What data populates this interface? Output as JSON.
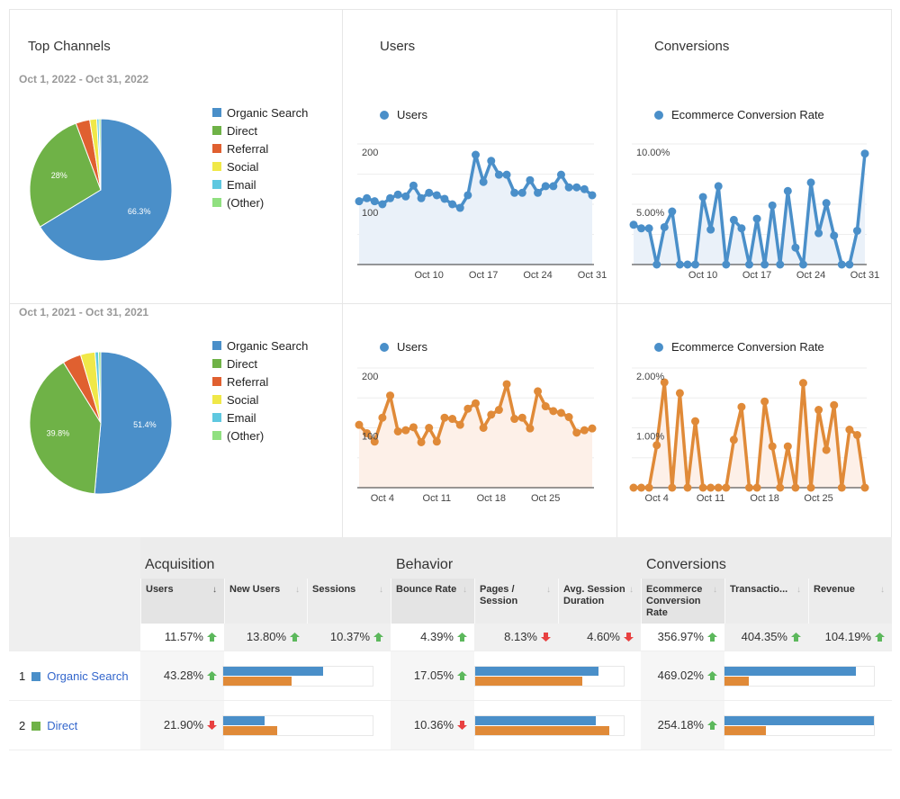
{
  "panels": {
    "top_channels_title": "Top Channels",
    "users_title": "Users",
    "conversions_title": "Conversions",
    "period_current": "Oct 1, 2022 - Oct 31, 2022",
    "period_previous": "Oct 1, 2021 - Oct 31, 2021"
  },
  "legend": [
    "Organic Search",
    "Direct",
    "Referral",
    "Social",
    "Email",
    "(Other)"
  ],
  "colors": {
    "organic": "#4a8fc9",
    "direct": "#6fb247",
    "referral": "#e06030",
    "social": "#f0e848",
    "email": "#5fc8e0",
    "other": "#90e080",
    "current_series": "#4a8fc9",
    "previous_series": "#e08a38",
    "up": "#5cb85c",
    "down": "#e84040"
  },
  "chart_data": [
    {
      "type": "pie",
      "name": "Top Channels 2022",
      "period": "Oct 1, 2022 - Oct 31, 2022",
      "labels": [
        "Organic Search",
        "Direct",
        "Referral",
        "Social",
        "Email",
        "(Other)"
      ],
      "values": [
        66.3,
        28.0,
        3.2,
        1.6,
        0.5,
        0.4
      ],
      "data_labels": [
        "66.3%",
        "28%",
        "",
        "",
        "",
        ""
      ]
    },
    {
      "type": "pie",
      "name": "Top Channels 2021",
      "period": "Oct 1, 2021 - Oct 31, 2021",
      "labels": [
        "Organic Search",
        "Direct",
        "Referral",
        "Social",
        "Email",
        "(Other)"
      ],
      "values": [
        51.4,
        39.8,
        4.2,
        3.3,
        0.8,
        0.5
      ],
      "data_labels": [
        "51.4%",
        "39.8%",
        "",
        "",
        "",
        ""
      ]
    },
    {
      "type": "area",
      "name": "Users 2022",
      "legend": "Users",
      "ylim": [
        0,
        200
      ],
      "yticks": [
        "200",
        "100"
      ],
      "xticks": [
        {
          "label": "Oct 10",
          "day": 10
        },
        {
          "label": "Oct 17",
          "day": 17
        },
        {
          "label": "Oct 24",
          "day": 24
        },
        {
          "label": "Oct 31",
          "day": 31
        }
      ],
      "values": [
        105,
        110,
        105,
        100,
        110,
        116,
        113,
        131,
        110,
        119,
        115,
        109,
        100,
        94,
        115,
        182,
        137,
        172,
        149,
        149,
        119,
        119,
        140,
        119,
        130,
        130,
        149,
        128,
        128,
        125,
        115
      ]
    },
    {
      "type": "area",
      "name": "Ecommerce Conversion Rate 2022",
      "legend": "Ecommerce Conversion Rate",
      "ylim": [
        0,
        10
      ],
      "yticks": [
        "10.00%",
        "5.00%"
      ],
      "xticks": [
        {
          "label": "Oct 10",
          "day": 10
        },
        {
          "label": "Oct 17",
          "day": 17
        },
        {
          "label": "Oct 24",
          "day": 24
        },
        {
          "label": "Oct 31",
          "day": 31
        }
      ],
      "values": [
        3.3,
        3.0,
        3.0,
        0,
        3.1,
        4.4,
        0,
        0,
        0,
        5.6,
        2.9,
        6.5,
        0,
        3.7,
        3.0,
        0,
        3.8,
        0,
        4.9,
        0,
        6.1,
        1.4,
        0,
        6.8,
        2.6,
        5.1,
        2.4,
        0,
        0,
        2.8,
        9.2
      ]
    },
    {
      "type": "area",
      "name": "Users 2021",
      "legend": "Users",
      "ylim": [
        0,
        200
      ],
      "yticks": [
        "200",
        "100"
      ],
      "xticks": [
        {
          "label": "Oct 4",
          "day": 4
        },
        {
          "label": "Oct 11",
          "day": 11
        },
        {
          "label": "Oct 18",
          "day": 18
        },
        {
          "label": "Oct 25",
          "day": 25
        }
      ],
      "values": [
        105,
        91,
        77,
        117,
        154,
        94,
        96,
        101,
        76,
        100,
        77,
        117,
        115,
        105,
        132,
        141,
        100,
        122,
        130,
        173,
        115,
        117,
        99,
        161,
        136,
        128,
        125,
        118,
        92,
        96,
        99
      ]
    },
    {
      "type": "area",
      "name": "Ecommerce Conversion Rate 2021",
      "legend": "Ecommerce Conversion Rate",
      "ylim": [
        0,
        2
      ],
      "yticks": [
        "2.00%",
        "1.00%"
      ],
      "xticks": [
        {
          "label": "Oct 4",
          "day": 4
        },
        {
          "label": "Oct 11",
          "day": 11
        },
        {
          "label": "Oct 18",
          "day": 18
        },
        {
          "label": "Oct 25",
          "day": 25
        }
      ],
      "values": [
        0,
        0,
        0,
        0.71,
        1.76,
        0,
        1.58,
        0,
        1.11,
        0,
        0,
        0,
        0,
        0.8,
        1.35,
        0,
        0,
        1.44,
        0.69,
        0,
        0.69,
        0,
        1.75,
        0,
        1.3,
        0.63,
        1.38,
        0,
        0.97,
        0.88,
        0
      ]
    }
  ],
  "table": {
    "groups": [
      "Acquisition",
      "Behavior",
      "Conversions"
    ],
    "columns": [
      {
        "label": "Users",
        "sorted": true
      },
      {
        "label": "New Users",
        "sorted": false
      },
      {
        "label": "Sessions",
        "sorted": false
      },
      {
        "label": "Bounce Rate",
        "sorted": false
      },
      {
        "label": "Pages / Session",
        "sorted": false
      },
      {
        "label": "Avg. Session Duration",
        "sorted": false
      },
      {
        "label": "Ecommerce Conversion Rate",
        "sorted": false
      },
      {
        "label": "Transactio...",
        "sorted": false
      },
      {
        "label": "Revenue",
        "sorted": false
      }
    ],
    "sort_icon": "arrow-down-icon",
    "totals": [
      {
        "value": "11.57%",
        "trend": "up"
      },
      {
        "value": "13.80%",
        "trend": "up"
      },
      {
        "value": "10.37%",
        "trend": "up"
      },
      {
        "value": "4.39%",
        "trend": "up"
      },
      {
        "value": "8.13%",
        "trend": "down"
      },
      {
        "value": "4.60%",
        "trend": "down"
      },
      {
        "value": "356.97%",
        "trend": "up"
      },
      {
        "value": "404.35%",
        "trend": "up"
      },
      {
        "value": "104.19%",
        "trend": "up"
      }
    ],
    "rows": [
      {
        "rank": "1",
        "channel": "Organic Search",
        "color": "#4a8fc9",
        "users": {
          "value": "43.28%",
          "trend": "up",
          "bar_current": 0.67,
          "bar_previous": 0.46
        },
        "bounce": {
          "value": "17.05%",
          "trend": "up",
          "bar_current": 0.83,
          "bar_previous": 0.72
        },
        "conversion": {
          "value": "469.02%",
          "trend": "up",
          "bar_current": 0.88,
          "bar_previous": 0.16
        }
      },
      {
        "rank": "2",
        "channel": "Direct",
        "color": "#6fb247",
        "users": {
          "value": "21.90%",
          "trend": "down",
          "bar_current": 0.28,
          "bar_previous": 0.36
        },
        "bounce": {
          "value": "10.36%",
          "trend": "down",
          "bar_current": 0.81,
          "bar_previous": 0.9
        },
        "conversion": {
          "value": "254.18%",
          "trend": "up",
          "bar_current": 1.0,
          "bar_previous": 0.28
        }
      }
    ]
  }
}
